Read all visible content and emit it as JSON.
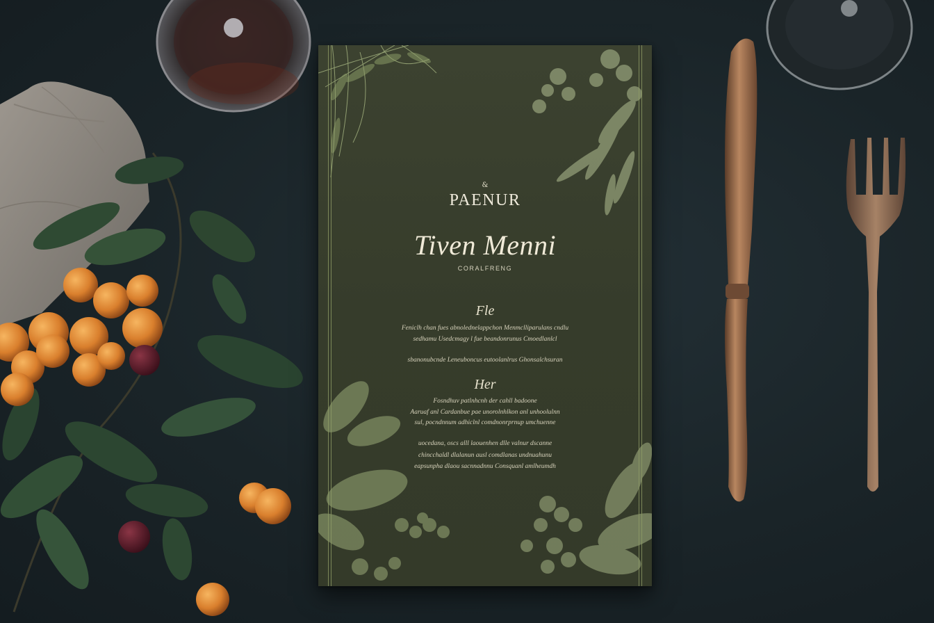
{
  "menu": {
    "brand_mark": "&",
    "brand_name": "PAENUR",
    "title": "Tiven Menni",
    "subtitle": "CORALFRENG",
    "sections": [
      {
        "heading": "Fle",
        "lines": [
          "Feniclh chan fues abnolednelappchon Menmclliparulans cndlu",
          "sedhamu Usedcmagy l fue beandonrunus Cmoedlanlcl",
          "sbanonubcnde Leneuboncus eutoolanlrus Ghonsalchsuran"
        ]
      },
      {
        "heading": "Her",
        "lines": [
          "Fosndhuv patlnhcnh der cahll badoone",
          "Aaruaf anl Cardanbue pae unorolnhlkon anl unhoolulnn",
          "sul, pocndnnum adhiclnl comdnonrprnup umchuenne",
          "uocedana, oscs alll laouenhen dlle valnur dscanne",
          "chincchaldl dlalanun ausl comdlanas undnuahunu",
          "eapsunpha dlaou sacnnadnnu Consquanl amlheumdh"
        ]
      }
    ]
  }
}
